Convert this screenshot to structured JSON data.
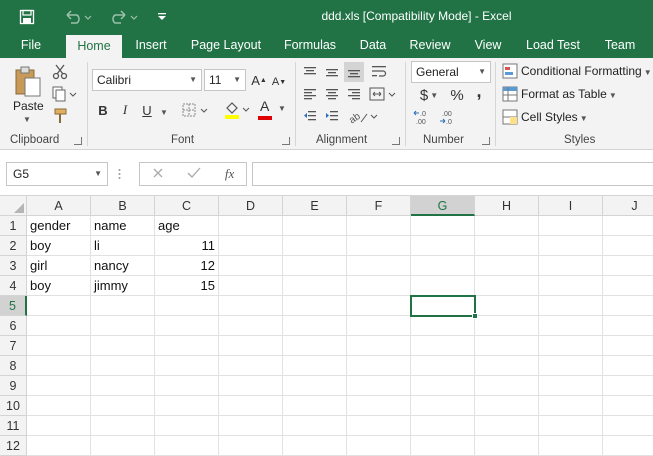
{
  "window": {
    "title": "ddd.xls  [Compatibility Mode] - Excel",
    "quick_access": [
      {
        "name": "save-icon"
      },
      {
        "name": "undo-icon"
      },
      {
        "name": "redo-icon"
      },
      {
        "name": "customize-qat-icon"
      }
    ],
    "accent": "#217346"
  },
  "tabs": [
    "File",
    "Home",
    "Insert",
    "Page Layout",
    "Formulas",
    "Data",
    "Review",
    "View",
    "Load Test",
    "Team"
  ],
  "active_tab": "Home",
  "ribbon": {
    "clipboard": {
      "paste_label": "Paste",
      "group_label": "Clipboard"
    },
    "font": {
      "font_name": "Calibri",
      "font_size": "11",
      "bold": "B",
      "italic": "I",
      "underline": "U",
      "font_color_glyph": "A",
      "group_label": "Font"
    },
    "alignment": {
      "group_label": "Alignment"
    },
    "number": {
      "format": "General",
      "currency": "$",
      "percent": "%",
      "comma": ",",
      "group_label": "Number"
    },
    "styles": {
      "conditional": "Conditional Formatting",
      "format_table": "Format as Table",
      "cell_styles": "Cell Styles",
      "group_label": "Styles"
    }
  },
  "formula_bar": {
    "name_box": "G5",
    "fx": "fx",
    "formula": ""
  },
  "sheet": {
    "columns": [
      "A",
      "B",
      "C",
      "D",
      "E",
      "F",
      "G",
      "H",
      "I",
      "J"
    ],
    "rows": [
      "1",
      "2",
      "3",
      "4",
      "5",
      "6",
      "7",
      "8",
      "9",
      "10",
      "11",
      "12"
    ],
    "cells": [
      [
        "gender",
        "name",
        "age"
      ],
      [
        "boy",
        "li",
        "11"
      ],
      [
        "girl",
        "nancy",
        "12"
      ],
      [
        "boy",
        "jimmy",
        "15"
      ]
    ],
    "selected_cell": "G5"
  }
}
